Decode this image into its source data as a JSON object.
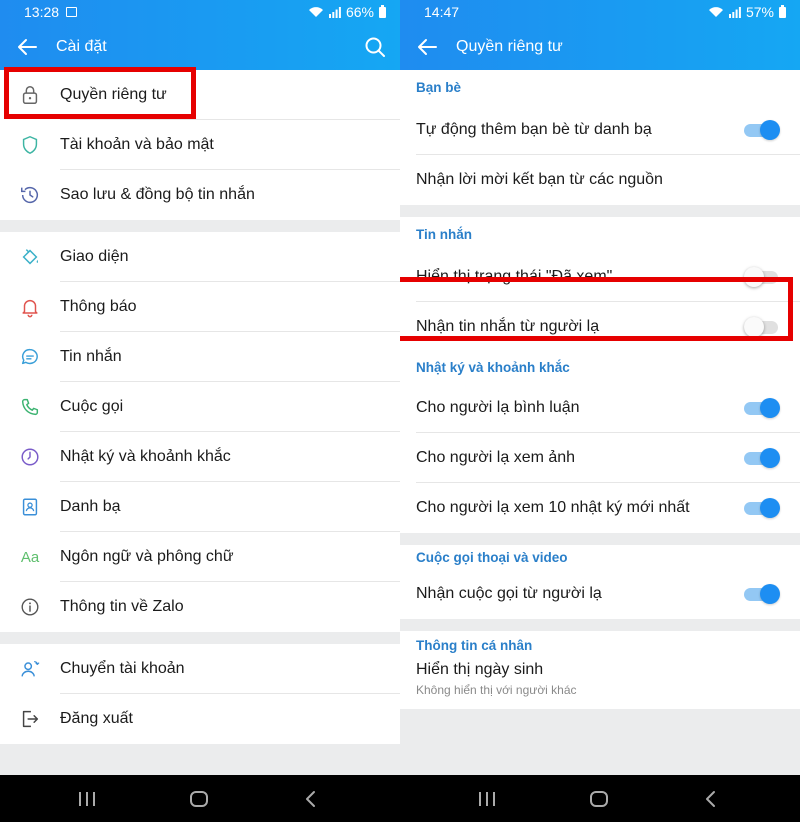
{
  "left": {
    "status": {
      "time": "13:28",
      "battery": "66%"
    },
    "title": "Cài đặt",
    "groups": [
      [
        {
          "label": "Quyền riêng tư",
          "icon": "lock-icon"
        },
        {
          "label": "Tài khoản và bảo mật",
          "icon": "shield-icon"
        },
        {
          "label": "Sao lưu & đồng bộ tin nhắn",
          "icon": "history-icon"
        }
      ],
      [
        {
          "label": "Giao diện",
          "icon": "paint-bucket-icon"
        },
        {
          "label": "Thông báo",
          "icon": "bell-icon"
        },
        {
          "label": "Tin nhắn",
          "icon": "chat-bubble-icon"
        },
        {
          "label": "Cuộc gọi",
          "icon": "phone-icon"
        },
        {
          "label": "Nhật ký và khoảnh khắc",
          "icon": "clock-icon"
        },
        {
          "label": "Danh bạ",
          "icon": "contact-card-icon"
        },
        {
          "label": "Ngôn ngữ và phông chữ",
          "icon": "font-aa-icon"
        },
        {
          "label": "Thông tin về Zalo",
          "icon": "info-icon"
        }
      ],
      [
        {
          "label": "Chuyển tài khoản",
          "icon": "switch-account-icon"
        },
        {
          "label": "Đăng xuất",
          "icon": "logout-icon"
        }
      ]
    ],
    "aa_text": "Aa"
  },
  "right": {
    "status": {
      "time": "14:47",
      "battery": "57%"
    },
    "title": "Quyền riêng tư",
    "sections": [
      {
        "title": "Bạn bè",
        "rows": [
          {
            "label": "Tự động thêm bạn bè từ danh bạ",
            "toggle": "on"
          },
          {
            "label": "Nhận lời mời kết bạn từ các nguồn"
          }
        ]
      },
      {
        "title": "Tin nhắn",
        "rows": [
          {
            "label": "Hiển thị trạng thái \"Đã xem\"",
            "toggle": "off"
          },
          {
            "label": "Nhận tin nhắn từ người lạ",
            "toggle": "off"
          }
        ]
      },
      {
        "title": "Nhật ký và khoảnh khắc",
        "rows": [
          {
            "label": "Cho người lạ bình luận",
            "toggle": "on"
          },
          {
            "label": "Cho người lạ xem ảnh",
            "toggle": "on"
          },
          {
            "label": "Cho người lạ xem 10 nhật ký mới nhất",
            "toggle": "on"
          }
        ]
      },
      {
        "title": "Cuộc gọi thoại và video",
        "rows": [
          {
            "label": "Nhận cuộc gọi từ người lạ",
            "toggle": "on"
          }
        ]
      },
      {
        "title": "Thông tin cá nhân",
        "rows": [
          {
            "label": "Hiển thị ngày sinh",
            "sub": "Không hiển thị với người khác"
          }
        ]
      }
    ]
  },
  "colors": {
    "header_start": "#1f8cf0",
    "header_end": "#15a7f3",
    "section_title": "#2a7fc9",
    "toggle_on": "#1d8ef2",
    "highlight": "#e60000"
  }
}
